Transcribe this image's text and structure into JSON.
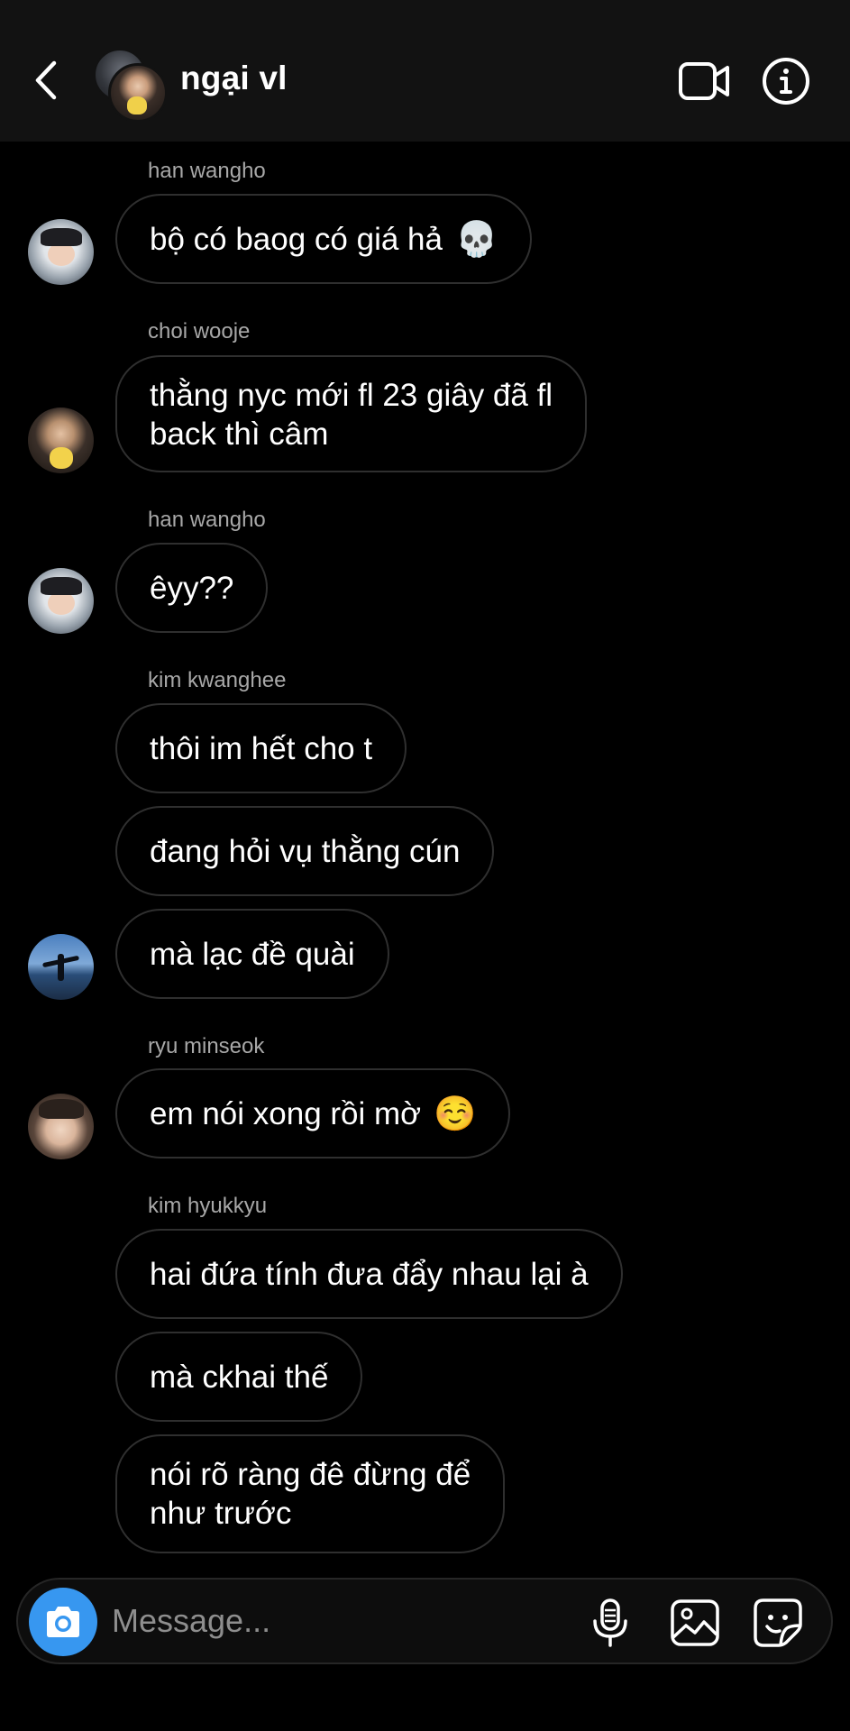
{
  "header": {
    "title": "ngại vl"
  },
  "messages": [
    {
      "sender": "han wangho",
      "avatar": "avatar-han-wangho",
      "lines": [
        "bộ có baog có giá hả"
      ],
      "emoji": "💀"
    },
    {
      "sender": "choi wooje",
      "avatar": "avatar-choi-wooje",
      "lines": [
        "thằng nyc mới fl 23 giây đã fl",
        "back thì câm"
      ]
    },
    {
      "sender": "han wangho",
      "avatar": "avatar-han-wangho",
      "lines": [
        "êyy??"
      ]
    },
    {
      "sender": "kim kwanghee",
      "avatar": "avatar-kim-kwanghee",
      "bubbles": [
        "thôi im hết cho t",
        "đang hỏi vụ thằng cún",
        "mà lạc đề quài"
      ]
    },
    {
      "sender": "ryu minseok",
      "avatar": "avatar-ryu-minseok",
      "lines": [
        "em nói xong rồi mờ"
      ],
      "emoji": "☺️"
    },
    {
      "sender": "kim hyukkyu",
      "bubbles": [
        "hai đứa tính đưa đẩy nhau lại à",
        "mà ckhai thế",
        "nói rõ ràng đê đừng để",
        "như trước"
      ]
    }
  ],
  "composer": {
    "placeholder": "Message..."
  },
  "icons": {
    "back": "chevron-left-icon",
    "video": "video-camera-icon",
    "info": "info-icon",
    "camera": "camera-icon",
    "mic": "microphone-icon",
    "gallery": "image-icon",
    "sticker": "sticker-icon"
  },
  "colors": {
    "background": "#000000",
    "header": "#121212",
    "accent": "#3797f0",
    "sender_text": "#a8a8a8",
    "bubble_border": "#2f2f2f"
  }
}
